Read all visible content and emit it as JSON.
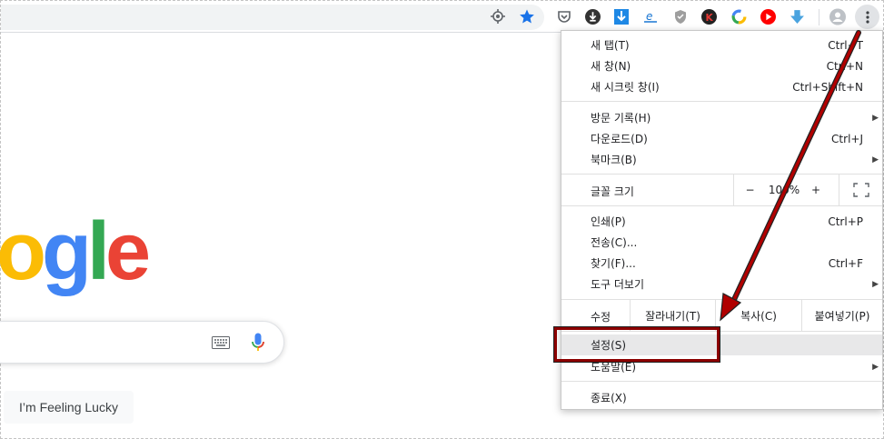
{
  "toolbar": {
    "icons": [
      "location-icon",
      "star-icon",
      "pocket-icon",
      "download-circle-icon",
      "download-arrow-icon",
      "extension-e-icon",
      "shield-icon",
      "k-icon",
      "google-c-icon",
      "youtube-icon",
      "down-arrow-icon",
      "profile-icon",
      "menu-icon"
    ],
    "colors": {
      "star": "#1a73e8",
      "youtube": "#ff0000",
      "download": "#1e88e5"
    }
  },
  "page": {
    "logo_text": "ogle",
    "lucky_button": "I’m Feeling Lucky"
  },
  "menu": {
    "new_tab": {
      "label": "새 탭(T)",
      "shortcut": "Ctrl+T"
    },
    "new_window": {
      "label": "새 창(N)",
      "shortcut": "Ctrl+N"
    },
    "incognito": {
      "label": "새 시크릿 창(I)",
      "shortcut": "Ctrl+Shift+N"
    },
    "history": {
      "label": "방문 기록(H)"
    },
    "downloads": {
      "label": "다운로드(D)",
      "shortcut": "Ctrl+J"
    },
    "bookmarks": {
      "label": "북마크(B)"
    },
    "zoom": {
      "label": "글꼴 크기",
      "minus": "−",
      "value": "100%",
      "plus": "+"
    },
    "print": {
      "label": "인쇄(P)",
      "shortcut": "Ctrl+P"
    },
    "cast": {
      "label": "전송(C)..."
    },
    "find": {
      "label": "찾기(F)...",
      "shortcut": "Ctrl+F"
    },
    "more_tools": {
      "label": "도구 더보기"
    },
    "edit": {
      "label": "수정",
      "cut": "잘라내기(T)",
      "copy": "복사(C)",
      "paste": "붙여넣기(P)"
    },
    "settings": {
      "label": "설정(S)"
    },
    "help": {
      "label": "도움말(E)"
    },
    "exit": {
      "label": "종료(X)"
    },
    "submenu_glyph": "▶"
  },
  "annotation": {
    "color": "#8b0000"
  }
}
